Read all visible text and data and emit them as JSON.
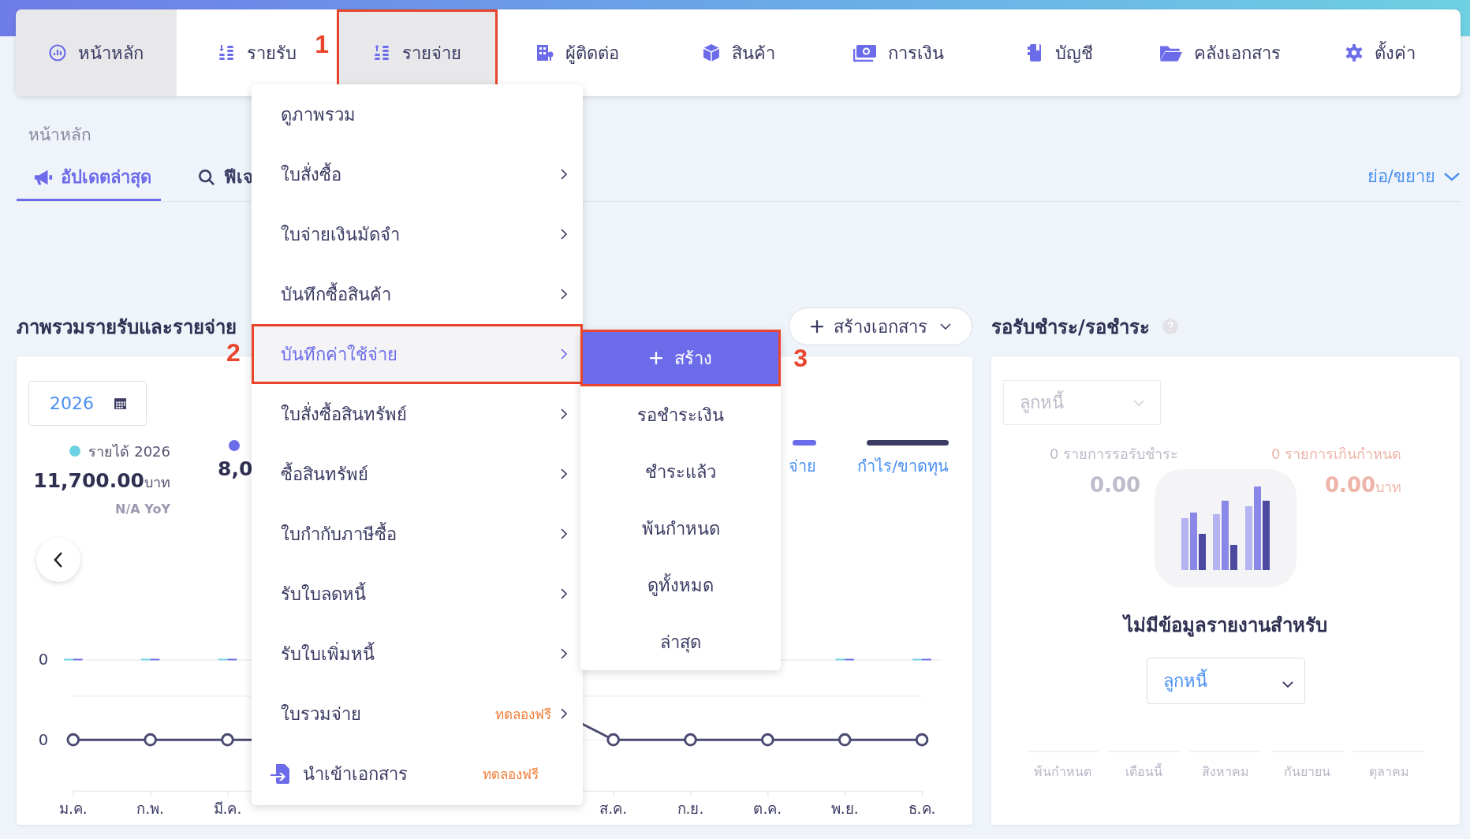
{
  "nav": {
    "items": [
      {
        "label": "หน้าหลัก",
        "selected": true,
        "highlighted": false
      },
      {
        "label": "รายรับ",
        "selected": false,
        "highlighted": false
      },
      {
        "label": "รายจ่าย",
        "selected": true,
        "highlighted": true,
        "marker": "1"
      },
      {
        "label": "ผู้ติดต่อ",
        "selected": false,
        "highlighted": false
      },
      {
        "label": "สินค้า",
        "selected": false,
        "highlighted": false
      },
      {
        "label": "การเงิน",
        "selected": false,
        "highlighted": false
      },
      {
        "label": "บัญชี",
        "selected": false,
        "highlighted": false
      },
      {
        "label": "คลังเอกสาร",
        "selected": false,
        "highlighted": false
      },
      {
        "label": "ตั้งค่า",
        "selected": false,
        "highlighted": false
      }
    ]
  },
  "breadcrumb": "หน้าหลัก",
  "tabs": [
    {
      "label": "อัปเดตล่าสุด",
      "selected": true
    },
    {
      "label": "ฟีเจ",
      "selected": false
    }
  ],
  "collapse_link": "ย่อ/ขยาย",
  "overview": {
    "title": "ภาพรวมรายรับและรายจ่าย",
    "create_button": "สร้างเอกสาร",
    "year": "2026",
    "stats": [
      {
        "label": "รายได้ 2026",
        "color": "#6dd3e3",
        "value": "11,700.00",
        "unit": "บาท",
        "yoy": "N/A YoY"
      },
      {
        "color": "#6c6cea",
        "value": "8,0"
      }
    ],
    "legend": [
      {
        "label": "จ่าย",
        "color": "#6c6cea"
      },
      {
        "label": "กำไร/ขาดทุน",
        "color": "#3b3b63"
      }
    ],
    "bar_axis_label": "0",
    "line_axis_label": "0",
    "months_left": [
      "ม.ค.",
      "ก.พ.",
      "มี.ค."
    ],
    "months_right": [
      "ส.ค.",
      "ก.ย.",
      "ต.ค.",
      "พ.ย.",
      "ธ.ค."
    ]
  },
  "payment_panel": {
    "title": "รอรับชำระ/รอชำระ",
    "select": "ลูกหนี้",
    "stats": [
      {
        "kind": "pending",
        "label": "0 รายการรอรับชำระ",
        "value": "0.00"
      },
      {
        "kind": "overdue",
        "label": "0 รายการเกินกำหนด",
        "value": "0.00",
        "unit": "บาท"
      }
    ],
    "periods": [
      "พ้นกำหนด",
      "เดือนนี้",
      "สิงหาคม",
      "กันยายน",
      "ตุลาคม"
    ],
    "empty_message": "ไม่มีข้อมูลรายงานสำหรับ",
    "empty_select": "ลูกหนี้"
  },
  "menu": {
    "items": [
      {
        "kind": "item",
        "label": "ดูภาพรวม",
        "submenu": false,
        "selected": false,
        "highlighted": false
      },
      {
        "kind": "item",
        "label": "ใบสั่งซื้อ",
        "submenu": true,
        "selected": false,
        "highlighted": false
      },
      {
        "kind": "item",
        "label": "ใบจ่ายเงินมัดจำ",
        "submenu": true,
        "selected": false,
        "highlighted": false
      },
      {
        "kind": "item",
        "label": "บันทึกซื้อสินค้า",
        "submenu": true,
        "selected": false,
        "highlighted": false
      },
      {
        "kind": "item",
        "label": "บันทึกค่าใช้จ่าย",
        "submenu": true,
        "selected": true,
        "highlighted": true,
        "marker": "2"
      },
      {
        "kind": "item",
        "label": "ใบสั่งซื้อสินทรัพย์",
        "submenu": true,
        "selected": false,
        "highlighted": false
      },
      {
        "kind": "item",
        "label": "ซื้อสินทรัพย์",
        "submenu": true,
        "selected": false,
        "highlighted": false
      },
      {
        "kind": "item",
        "label": "ใบกำกับภาษีซื้อ",
        "submenu": true,
        "selected": false,
        "highlighted": false
      },
      {
        "kind": "item",
        "label": "รับใบลดหนี้",
        "submenu": true,
        "selected": false,
        "highlighted": false
      },
      {
        "kind": "item",
        "label": "รับใบเพิ่มหนี้",
        "submenu": true,
        "selected": false,
        "highlighted": false
      },
      {
        "kind": "item",
        "label": "ใบรวมจ่าย",
        "badge": "ทดลองฟรี",
        "submenu": true,
        "selected": false,
        "highlighted": false
      },
      {
        "kind": "import",
        "label": "นำเข้าเอกสาร",
        "badge": "ทดลองฟรี",
        "submenu": false,
        "selected": false,
        "highlighted": false
      }
    ]
  },
  "submenu": {
    "items": [
      {
        "kind": "create",
        "label": "สร้าง",
        "selected": true,
        "highlighted": true,
        "marker": "3"
      },
      {
        "kind": "item",
        "label": "รอชำระเงิน",
        "selected": false,
        "highlighted": false
      },
      {
        "kind": "item",
        "label": "ชำระแล้ว",
        "selected": false,
        "highlighted": false
      },
      {
        "kind": "item",
        "label": "พ้นกำหนด",
        "selected": false,
        "highlighted": false
      },
      {
        "kind": "item",
        "label": "ดูทั้งหมด",
        "selected": false,
        "highlighted": false
      },
      {
        "kind": "item",
        "label": "ล่าสุด",
        "selected": false,
        "highlighted": false
      }
    ]
  }
}
